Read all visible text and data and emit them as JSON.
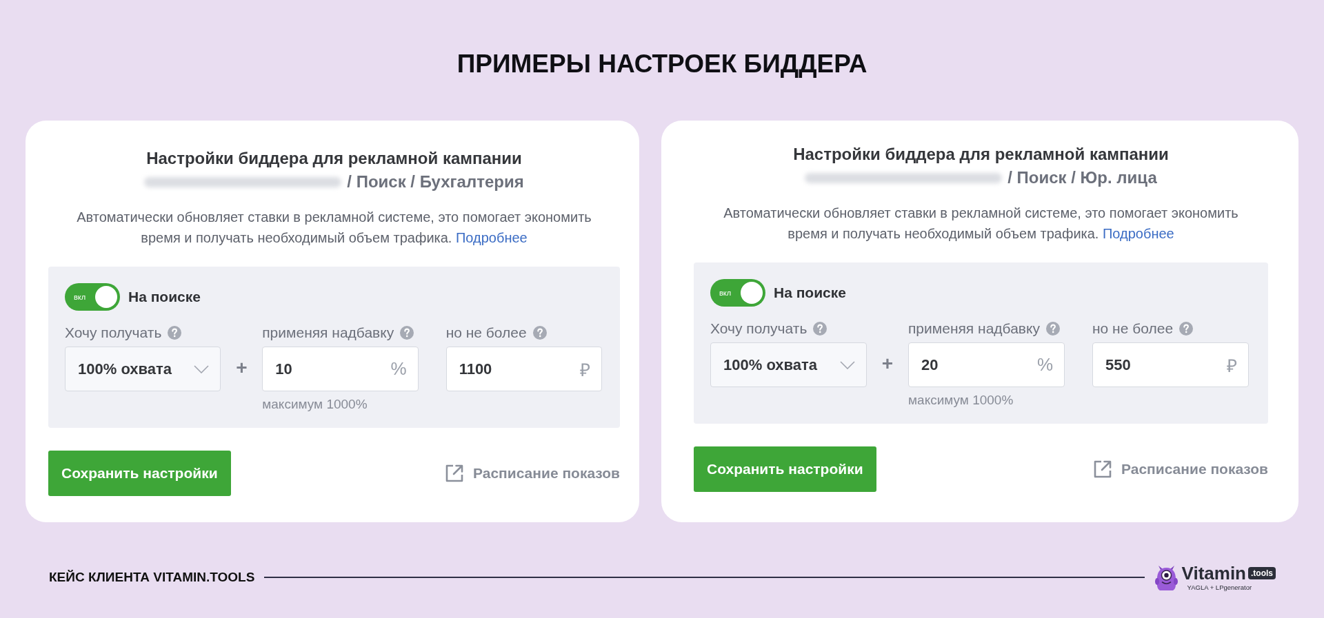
{
  "title": "ПРИМЕРЫ НАСТРОЕК БИДДЕРА",
  "cards": [
    {
      "heading": "Настройки биддера для рекламной кампании",
      "path": "/ Поиск / Бухгалтерия",
      "description": "Автоматически обновляет ставки в рекламной системе, это помогает экономить время и получать необходимый объем трафика.",
      "more_link": "Подробнее",
      "toggle": {
        "text": "вкл",
        "on": true,
        "label": "На поиске"
      },
      "fields": [
        {
          "kind": "select",
          "label": "Хочу получать",
          "help": true,
          "value": "100% охвата"
        },
        {
          "kind": "input",
          "operator": "+",
          "label": "применяя надбавку",
          "help": true,
          "value": "10",
          "suffix": "%",
          "hint": "максимум 1000%"
        },
        {
          "kind": "input",
          "label": "но не более",
          "help": true,
          "value": "1100",
          "suffix": "₽"
        }
      ],
      "save_button": "Сохранить настройки",
      "schedule_link": "Расписание показов"
    },
    {
      "heading": "Настройки биддера для рекламной кампании",
      "path": "/ Поиск / Юр. лица",
      "description": "Автоматически обновляет ставки в рекламной системе, это помогает экономить время и получать необходимый объем трафика.",
      "more_link": "Подробнее",
      "toggle": {
        "text": "вкл",
        "on": true,
        "label": "На поиске"
      },
      "fields": [
        {
          "kind": "select",
          "label": "Хочу получать",
          "help": true,
          "value": "100% охвата"
        },
        {
          "kind": "input",
          "operator": "+",
          "label": "применяя надбавку",
          "help": true,
          "value": "20",
          "suffix": "%",
          "hint": "максимум 1000%"
        },
        {
          "kind": "input",
          "label": "но не более",
          "help": true,
          "value": "550",
          "suffix": "₽"
        }
      ],
      "save_button": "Сохранить настройки",
      "schedule_link": "Расписание показов"
    }
  ],
  "footer": {
    "caption": "КЕЙС КЛИЕНТА VITAMIN.TOOLS",
    "logo": {
      "name": "Vitamin",
      "badge": ".tools",
      "tagline": "YAGLA + LPgenerator"
    }
  }
}
